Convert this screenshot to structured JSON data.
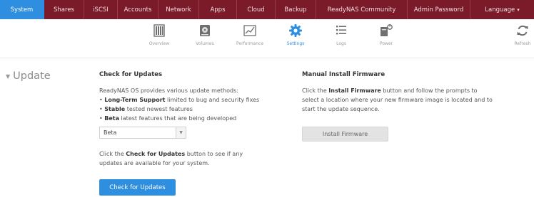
{
  "topnav": {
    "tabs": [
      {
        "label": "System",
        "active": true
      },
      {
        "label": "Shares",
        "active": false
      },
      {
        "label": "iSCSI",
        "active": false
      },
      {
        "label": "Accounts",
        "active": false
      },
      {
        "label": "Network",
        "active": false
      },
      {
        "label": "Apps",
        "active": false
      },
      {
        "label": "Cloud",
        "active": false
      },
      {
        "label": "Backup",
        "active": false
      },
      {
        "label": "ReadyNAS Community",
        "active": false
      },
      {
        "label": "Admin Password",
        "active": false
      },
      {
        "label": "Language",
        "active": false
      }
    ],
    "language_caret": "▾",
    "accent_color": "#2e8ee0",
    "bar_color": "#7b1a28"
  },
  "subnav": {
    "items": [
      {
        "label": "Overview",
        "icon": "overview-icon",
        "active": false
      },
      {
        "label": "Volumes",
        "icon": "volumes-icon",
        "active": false
      },
      {
        "label": "Performance",
        "icon": "performance-icon",
        "active": false
      },
      {
        "label": "Settings",
        "icon": "gear-icon",
        "active": true
      },
      {
        "label": "Logs",
        "icon": "logs-icon",
        "active": false
      },
      {
        "label": "Power",
        "icon": "power-icon",
        "active": false
      },
      {
        "label": "Refresh",
        "icon": "refresh-icon",
        "active": false
      }
    ]
  },
  "section": {
    "title": "Update",
    "collapse_glyph": "▼"
  },
  "check_updates": {
    "heading": "Check for Updates",
    "intro": "ReadyNAS OS provides various update methods:",
    "bullets": [
      {
        "bold": "Long-Term Support",
        "text": " limited to bug and security fixes"
      },
      {
        "bold": "Stable",
        "text": " tested newest features"
      },
      {
        "bold": "Beta",
        "text": " latest features that are being developed"
      }
    ],
    "bullet_glyph": "•",
    "channel_select": {
      "value": "Beta",
      "arrow": "▼"
    },
    "hint_before": "Click the ",
    "hint_bold": "Check for Updates",
    "hint_after": " button to see if any updates are available for your system.",
    "button_label": "Check for Updates"
  },
  "manual_install": {
    "heading": "Manual Install Firmware",
    "text_before": "Click the ",
    "text_bold": "Install Firmware",
    "text_after": " button and follow the prompts to select a location where your new firmware image is located and to start the update sequence.",
    "button_label": "Install Firmware"
  }
}
